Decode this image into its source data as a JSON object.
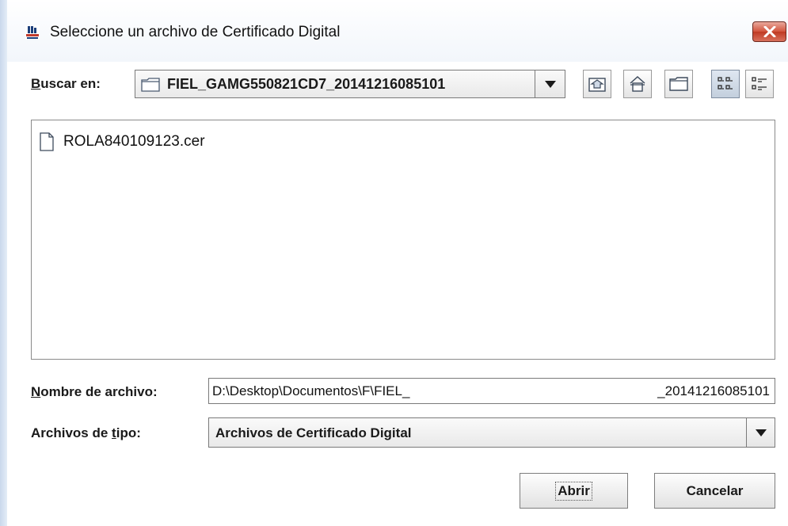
{
  "window": {
    "title": "Seleccione un archivo de Certificado Digital",
    "close_label": "X"
  },
  "lookin": {
    "label_prefix": "B",
    "label_rest": "uscar en:",
    "current_folder": "FIEL_GAMG550821CD7_20141216085101"
  },
  "toolbar": {
    "buttons": [
      "up-folder-icon",
      "home-icon",
      "new-folder-icon",
      "list-view-icon",
      "details-view-icon"
    ]
  },
  "files": [
    {
      "name": "ROLA840109123.cer",
      "icon": "file-icon"
    }
  ],
  "filename": {
    "label_prefix": "N",
    "label_rest": "ombre de archivo:",
    "value_start": "D:\\Desktop\\Documentos\\F\\FIEL_",
    "value_end": "_20141216085101"
  },
  "filetype": {
    "label_start": "Archivos de ",
    "label_underlined": "t",
    "label_end": "ipo:",
    "selected": "Archivos de Certificado Digital"
  },
  "buttons": {
    "open": "Abrir",
    "cancel": "Cancelar"
  },
  "colors": {
    "close_button": "#c8452e",
    "active_toolbar": "#c9d5e3"
  }
}
